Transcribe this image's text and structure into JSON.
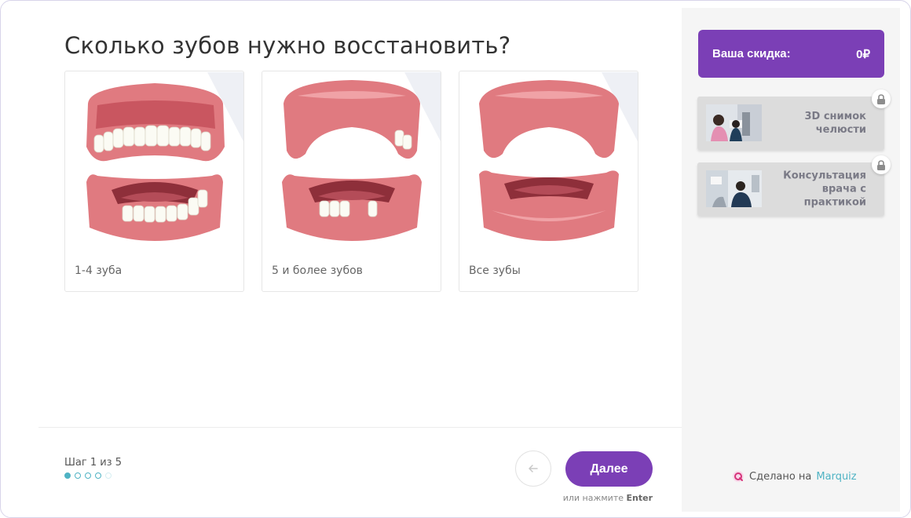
{
  "quiz": {
    "question": "Сколько зубов нужно восстановить?",
    "options": [
      {
        "label": "1-4 зуба",
        "icon": "jaw-missing-few-teeth-image"
      },
      {
        "label": "5 и более зубов",
        "icon": "jaw-missing-many-teeth-image"
      },
      {
        "label": "Все зубы",
        "icon": "jaw-no-teeth-image"
      }
    ]
  },
  "footer": {
    "step_text": "Шаг 1 из 5",
    "total_steps": 5,
    "current_step": 1,
    "back_icon": "arrow-left-icon",
    "next_label": "Далее",
    "hint_prefix": "или нажмите",
    "hint_key": "Enter"
  },
  "sidebar": {
    "discount_label": "Ваша скидка:",
    "discount_value": "0₽",
    "bonuses": [
      {
        "text": "3D снимок челюсти",
        "locked": true,
        "icon": "lock-icon"
      },
      {
        "text": "Консультация врача с практикой",
        "locked": true,
        "icon": "lock-icon"
      }
    ],
    "made_with_prefix": "Сделано на",
    "made_with_brand": "Marquiz"
  },
  "colors": {
    "accent": "#7b3fb6",
    "progress": "#4fb3c4",
    "gum": "#e07a80",
    "tooth": "#fbfbf4"
  }
}
